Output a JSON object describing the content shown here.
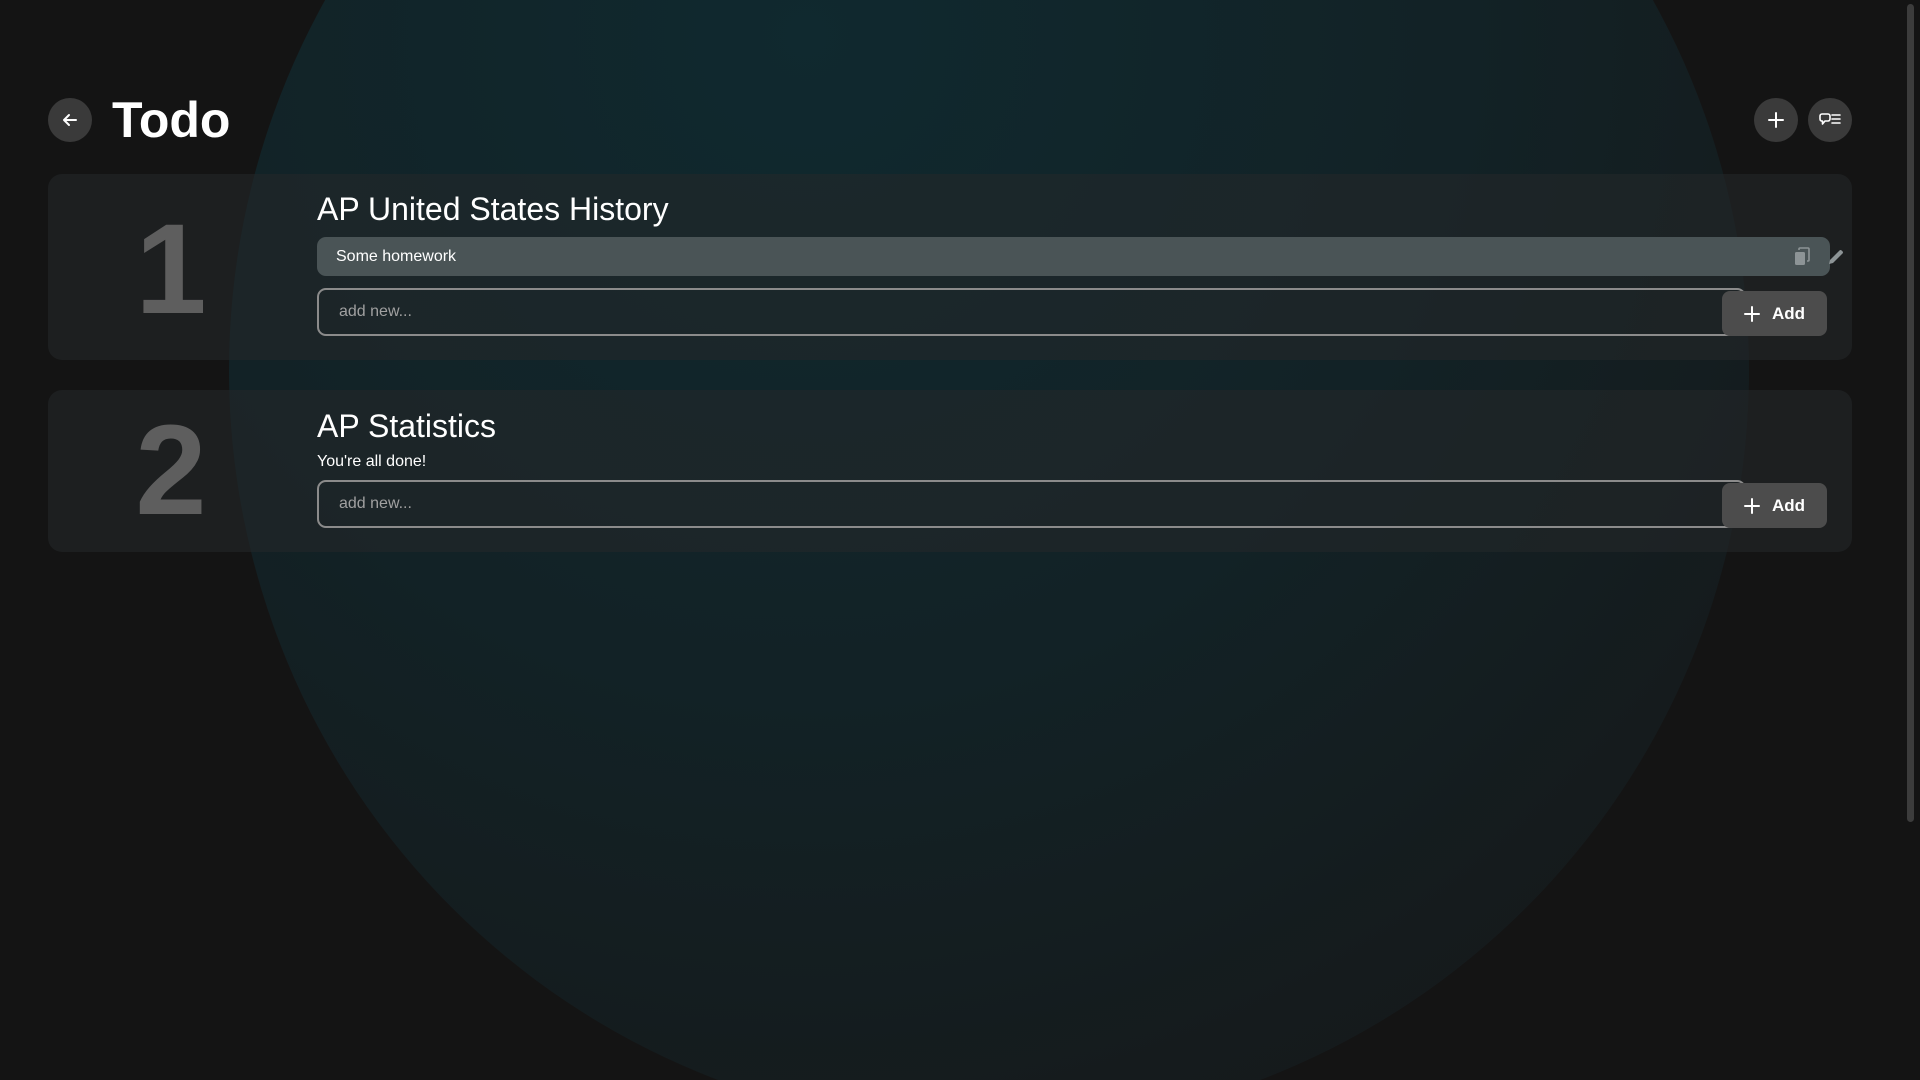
{
  "header": {
    "title": "Todo",
    "back_icon": "arrow-left-icon",
    "add_icon": "plus-icon",
    "feedback_icon": "message-list-icon"
  },
  "classes": [
    {
      "number": "1",
      "title": "AP United States History",
      "tasks": [
        {
          "text": "Some homework",
          "copy_icon": "copy-icon",
          "edit_icon": "pencil-icon"
        }
      ],
      "input_placeholder": "add new...",
      "add_button_label": "Add"
    },
    {
      "number": "2",
      "title": "AP Statistics",
      "empty_message": "You're all done!",
      "input_placeholder": "add new...",
      "add_button_label": "Add"
    }
  ],
  "colors": {
    "background": "#141414",
    "card": "#24282a",
    "task_row": "#4a5456",
    "number": "#5e5e5e",
    "button": "#4c4c4c",
    "accent_glow": "#10292f"
  }
}
